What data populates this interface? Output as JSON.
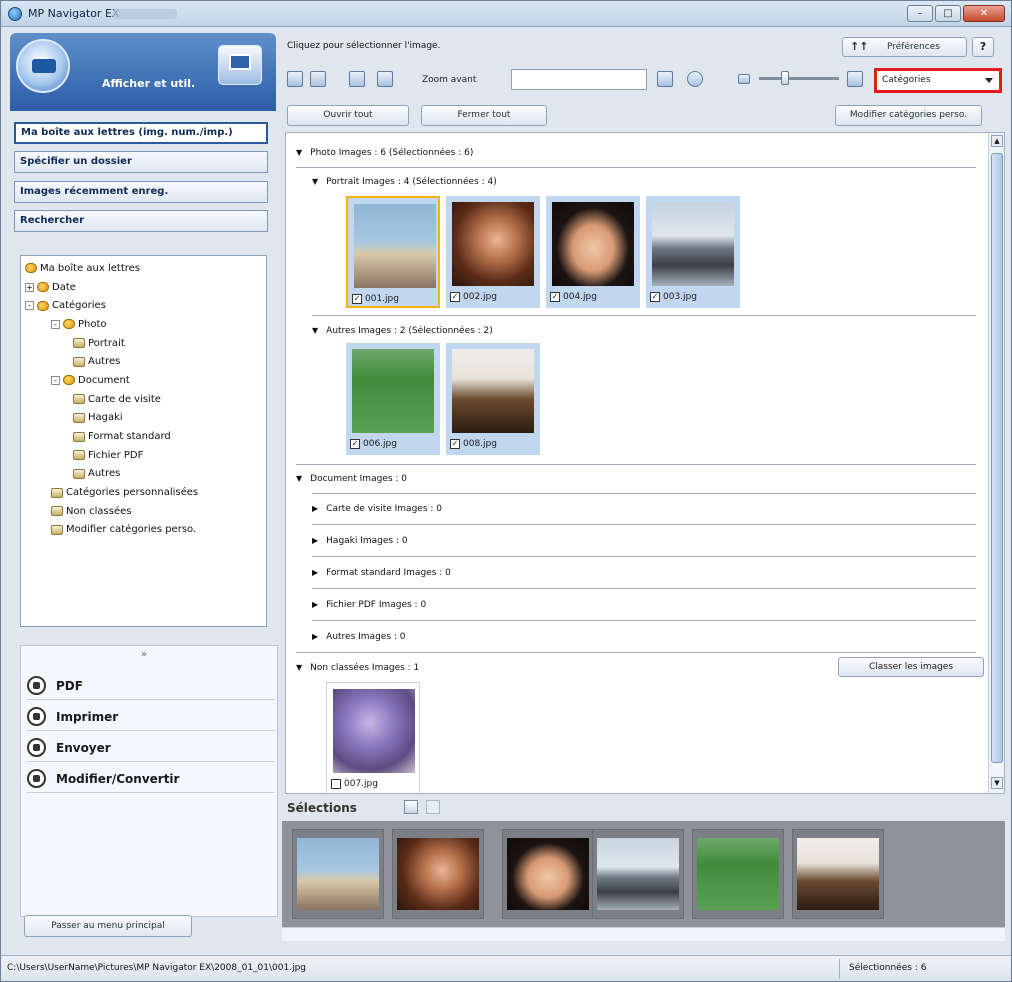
{
  "window": {
    "title": "MP Navigator EX"
  },
  "left": {
    "banner_title": "Afficher et util.",
    "nav": [
      {
        "label": "Ma boîte aux lettres (img. num./imp.)",
        "active": true
      },
      {
        "label": "Spécifier un dossier"
      },
      {
        "label": "Images récemment enreg."
      },
      {
        "label": "Rechercher"
      }
    ],
    "tree": [
      {
        "label": "Ma boîte aux lettres",
        "level": 0,
        "icon": "mailbox-icon"
      },
      {
        "label": "Date",
        "level": 1,
        "toggle": "+",
        "icon": "folder-icon"
      },
      {
        "label": "Catégories",
        "level": 1,
        "toggle": "-",
        "icon": "folder-icon"
      },
      {
        "label": "Photo",
        "level": 2,
        "toggle": "-",
        "icon": "folder-icon"
      },
      {
        "label": "Portrait",
        "level": 3,
        "icon": "category-icon"
      },
      {
        "label": "Autres",
        "level": 3,
        "icon": "category-icon"
      },
      {
        "label": "Document",
        "level": 2,
        "toggle": "-",
        "icon": "folder-icon"
      },
      {
        "label": "Carte de visite",
        "level": 3,
        "icon": "category-icon"
      },
      {
        "label": "Hagaki",
        "level": 3,
        "icon": "category-icon"
      },
      {
        "label": "Format standard",
        "level": 3,
        "icon": "category-icon"
      },
      {
        "label": "Fichier PDF",
        "level": 3,
        "icon": "category-icon"
      },
      {
        "label": "Autres",
        "level": 3,
        "icon": "category-icon"
      },
      {
        "label": "Catégories personnalisées",
        "level": 2,
        "icon": "category-icon"
      },
      {
        "label": "Non classées",
        "level": 2,
        "icon": "category-icon"
      },
      {
        "label": "Modifier catégories perso.",
        "level": 2,
        "icon": "category-icon"
      }
    ],
    "actions": {
      "chev": "»",
      "pdf": "PDF",
      "print": "Imprimer",
      "send": "Envoyer",
      "edit": "Modifier/Convertir"
    },
    "main_menu": "Passer au menu principal"
  },
  "right": {
    "hint": "Cliquez pour sélectionner l'image.",
    "prefs_icon": "↑↑",
    "prefs": "Préférences",
    "help": "?",
    "zoom": "Zoom avant",
    "view_select": "Catégories",
    "open_all": "Ouvrir tout",
    "close_all": "Fermer tout",
    "edit_cats": "Modifier catégories perso.",
    "sections": {
      "photo": "Photo   Images : 6   (Sélectionnées : 6)",
      "portrait": "Portrait   Images : 4   (Sélectionnées : 4)",
      "autres": "Autres   Images : 2   (Sélectionnées : 2)",
      "document": "Document   Images : 0",
      "carte": "Carte de visite   Images : 0",
      "hagaki": "Hagaki   Images : 0",
      "format": "Format standard   Images : 0",
      "pdf": "Fichier PDF   Images : 0",
      "autres2": "Autres   Images : 0",
      "nonclass": "Non classées   Images : 1"
    },
    "files": {
      "f1": "001.jpg",
      "f2": "002.jpg",
      "f4": "004.jpg",
      "f3": "003.jpg",
      "f6": "006.jpg",
      "f8": "008.jpg",
      "f7": "007.jpg"
    },
    "classify": "Classer les images",
    "selections": "Sélections"
  },
  "status": {
    "path": "C:\\Users\\UserName\\Pictures\\MP Navigator EX\\2008_01_01\\001.jpg",
    "count": "Sélectionnées : 6"
  }
}
